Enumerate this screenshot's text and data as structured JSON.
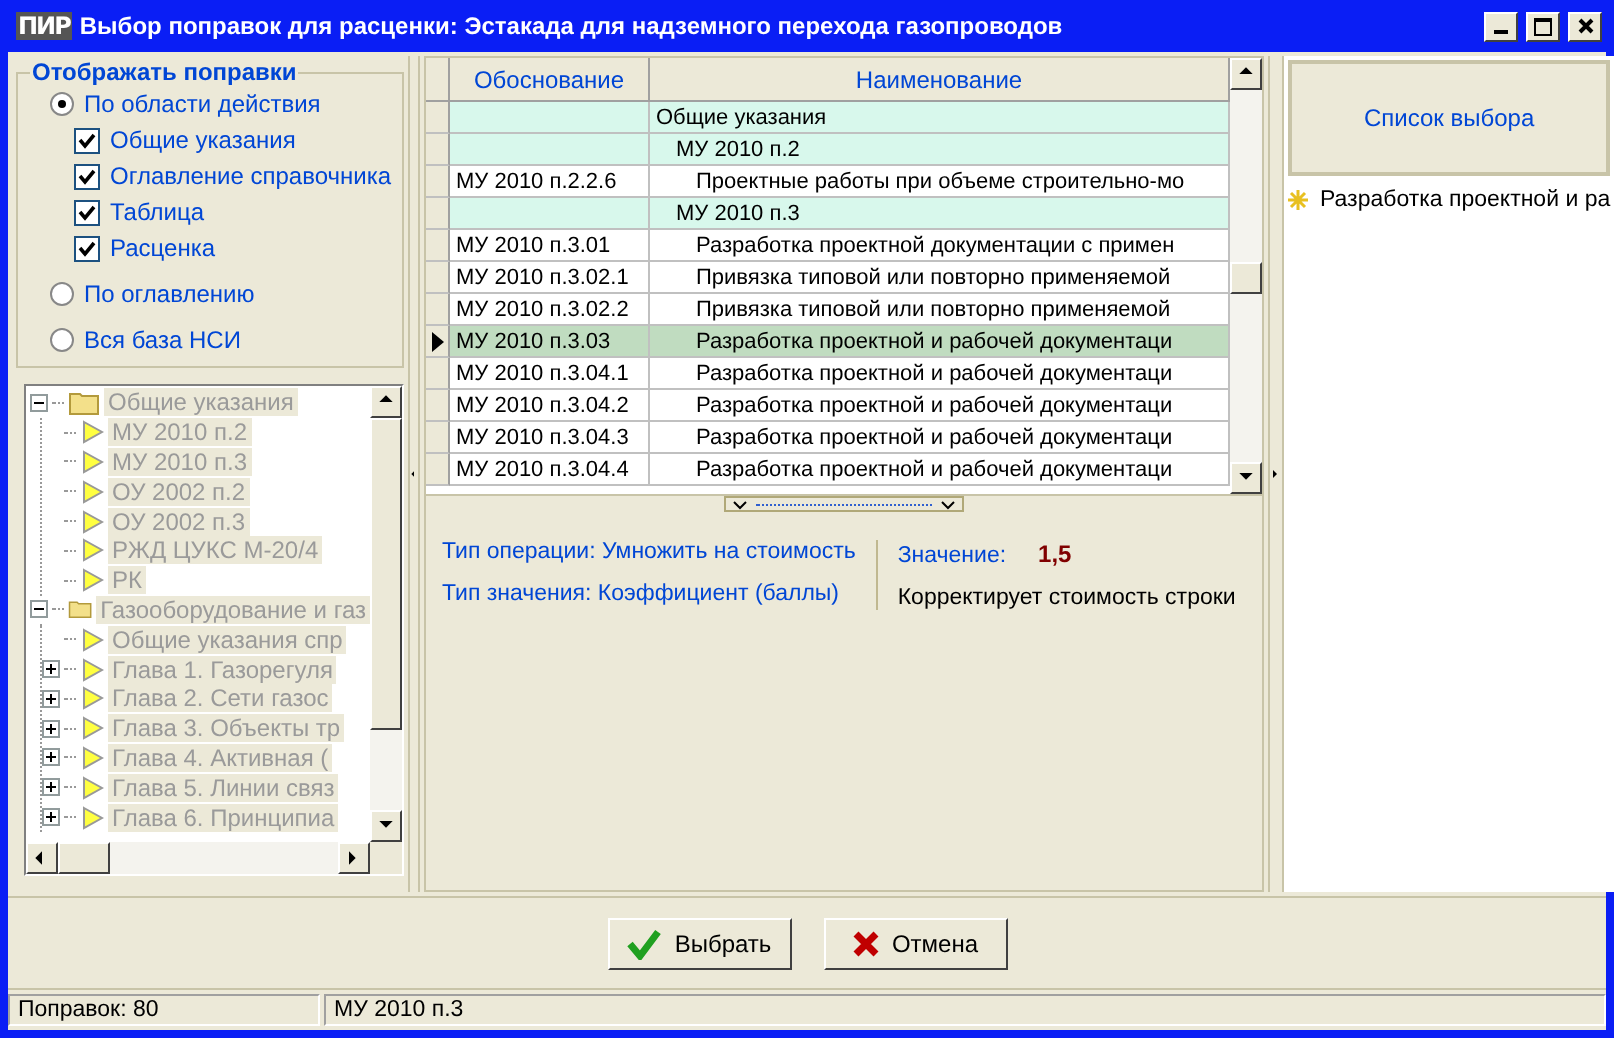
{
  "window": {
    "logo": "ПИР",
    "title": "Выбор поправок для расценки: Эстакада для надземного перехода газопроводов"
  },
  "filter": {
    "title": "Отображать поправки",
    "modes": [
      {
        "label": "По области действия",
        "selected": true,
        "checkboxes": [
          {
            "label": "Общие указания",
            "checked": true
          },
          {
            "label": "Оглавление справочника",
            "checked": true
          },
          {
            "label": "Таблица",
            "checked": true
          },
          {
            "label": "Расценка",
            "checked": true
          }
        ]
      },
      {
        "label": "По оглавлению",
        "selected": false
      },
      {
        "label": "Вся база НСИ",
        "selected": false
      }
    ]
  },
  "tree": {
    "disabled": true,
    "nodes": [
      {
        "label": "Общие указания",
        "kind": "folder",
        "expanded": true,
        "children": [
          {
            "label": "МУ 2010 п.2",
            "kind": "leaf"
          },
          {
            "label": "МУ 2010 п.3",
            "kind": "leaf"
          },
          {
            "label": "ОУ 2002 п.2",
            "kind": "leaf"
          },
          {
            "label": "ОУ 2002 п.3",
            "kind": "leaf"
          },
          {
            "label": "РЖД ЦУКС М-20/4",
            "kind": "leaf"
          },
          {
            "label": "РК",
            "kind": "leaf"
          }
        ]
      },
      {
        "label": "Газооборудование и газ",
        "kind": "folder",
        "expanded": true,
        "children": [
          {
            "label": "Общие указания спр",
            "kind": "leaf"
          },
          {
            "label": "Глава 1. Газорегуля",
            "kind": "leaf",
            "expanded": false
          },
          {
            "label": "Глава 2. Сети газос",
            "kind": "leaf",
            "expanded": false
          },
          {
            "label": "Глава 3. Объекты тр",
            "kind": "leaf",
            "expanded": false
          },
          {
            "label": "Глава 4. Активная (",
            "kind": "leaf",
            "expanded": false
          },
          {
            "label": "Глава 5. Линии связ",
            "kind": "leaf",
            "expanded": false
          },
          {
            "label": "Глава 6. Принципиа",
            "kind": "leaf",
            "expanded": false
          }
        ]
      }
    ]
  },
  "grid": {
    "columns": [
      "Обоснование",
      "Наименование"
    ],
    "rows": [
      {
        "kind": "group",
        "name": "Общие указания",
        "children": [
          {
            "kind": "group",
            "name": "МУ 2010 п.2",
            "children": [
              {
                "kind": "item",
                "code": "МУ 2010 п.2.2.6",
                "name": "Проектные работы при объеме строительно-мо",
                "selected": false
              }
            ]
          },
          {
            "kind": "group",
            "name": "МУ 2010 п.3",
            "children": [
              {
                "kind": "item",
                "code": "МУ 2010 п.3.01",
                "name": "Разработка проектной документации с примен",
                "selected": false
              },
              {
                "kind": "item",
                "code": "МУ 2010 п.3.02.1",
                "name": "Привязка типовой или повторно применяемой",
                "selected": false
              },
              {
                "kind": "item",
                "code": "МУ 2010 п.3.02.2",
                "name": "Привязка типовой или повторно применяемой",
                "selected": false
              },
              {
                "kind": "item",
                "code": "МУ 2010 п.3.03",
                "name": "Разработка проектной и рабочей документаци",
                "selected": true
              },
              {
                "kind": "item",
                "code": "МУ 2010 п.3.04.1",
                "name": "Разработка проектной и рабочей документаци",
                "selected": false
              },
              {
                "kind": "item",
                "code": "МУ 2010 п.3.04.2",
                "name": "Разработка проектной и рабочей документаци",
                "selected": false
              },
              {
                "kind": "item",
                "code": "МУ 2010 п.3.04.3",
                "name": "Разработка проектной и рабочей документаци",
                "selected": false
              },
              {
                "kind": "item",
                "code": "МУ 2010 п.3.04.4",
                "name": "Разработка проектной и рабочей документаци",
                "selected": false
              }
            ]
          }
        ]
      }
    ]
  },
  "details": {
    "operation": "Тип операции: Умножить на стоимость",
    "value_type": "Тип значения: Коэффициент (баллы)",
    "value_label": "Значение:",
    "value": "1,5",
    "description": "Корректирует стоимость строки"
  },
  "selection": {
    "title": "Список выбора",
    "items": [
      "Разработка проектной и ра"
    ]
  },
  "buttons": [
    {
      "kind": "ok",
      "label": "Выбрать"
    },
    {
      "kind": "cancel",
      "label": "Отмена"
    }
  ],
  "status_bar": [
    "Поправок: 80",
    "МУ 2010 п.3"
  ]
}
